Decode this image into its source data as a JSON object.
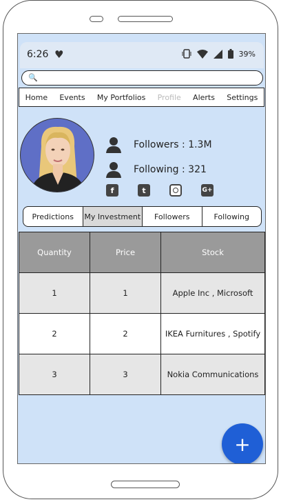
{
  "status_bar": {
    "time": "6:26",
    "battery": "39%"
  },
  "search": {
    "placeholder": ""
  },
  "nav": {
    "items": [
      {
        "label": "Home"
      },
      {
        "label": "Events"
      },
      {
        "label": "My Portfolios"
      },
      {
        "label": "Profile"
      },
      {
        "label": "Alerts"
      },
      {
        "label": "Settings"
      }
    ]
  },
  "profile": {
    "followers": "Followers : 1.3M",
    "following": "Following : 321",
    "socials": [
      "facebook-icon",
      "twitter-icon",
      "instagram-icon",
      "google-plus-icon"
    ]
  },
  "tabs": [
    {
      "label": "Predictions"
    },
    {
      "label": "My Investment"
    },
    {
      "label": "Followers"
    },
    {
      "label": "Following"
    }
  ],
  "table": {
    "headers": [
      "Quantity",
      "Price",
      "Stock"
    ],
    "rows": [
      [
        "1",
        "1",
        "Apple Inc , Microsoft"
      ],
      [
        "2",
        "2",
        "IKEA Furnitures , Spotify"
      ],
      [
        "3",
        "3",
        "Nokia Communications"
      ]
    ]
  },
  "fab": {
    "label": "+"
  },
  "colors": {
    "screen_bg": "#cfe2f8",
    "fab": "#1f5fd6",
    "avatar_bg": "#5f6fc6",
    "table_header": "#9a9a9a"
  }
}
